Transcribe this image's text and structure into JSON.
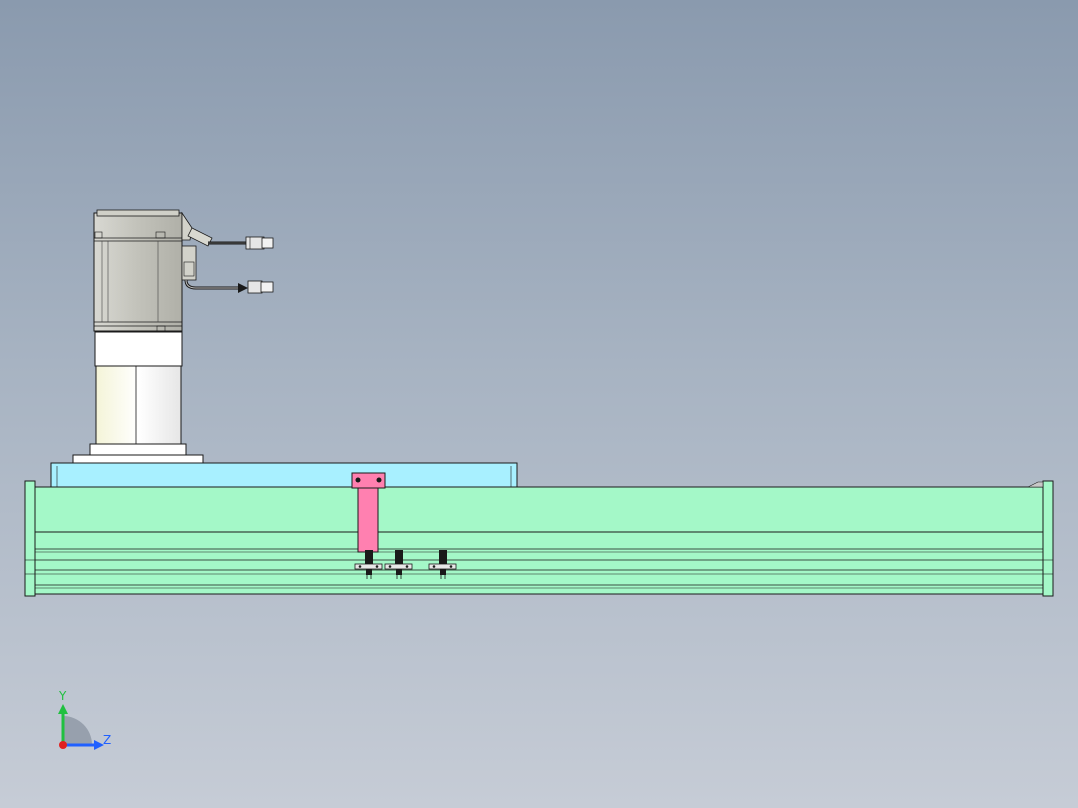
{
  "viewport": {
    "background_top": "#8a9aae",
    "background_bottom": "#c6ccd6"
  },
  "model": {
    "motor_color": "#c4c4bc",
    "coupling_color": "#ffffff",
    "mount_plate_color": "#a8f0ff",
    "rail_color": "#a4f8c8",
    "carriage_bracket_color": "#ff80b0",
    "outline_color": "#1a1a1a"
  },
  "triad": {
    "y_label": "Y",
    "z_label": "Z",
    "y_color": "#20c040",
    "z_color": "#2060ff",
    "x_color": "#e02020"
  }
}
